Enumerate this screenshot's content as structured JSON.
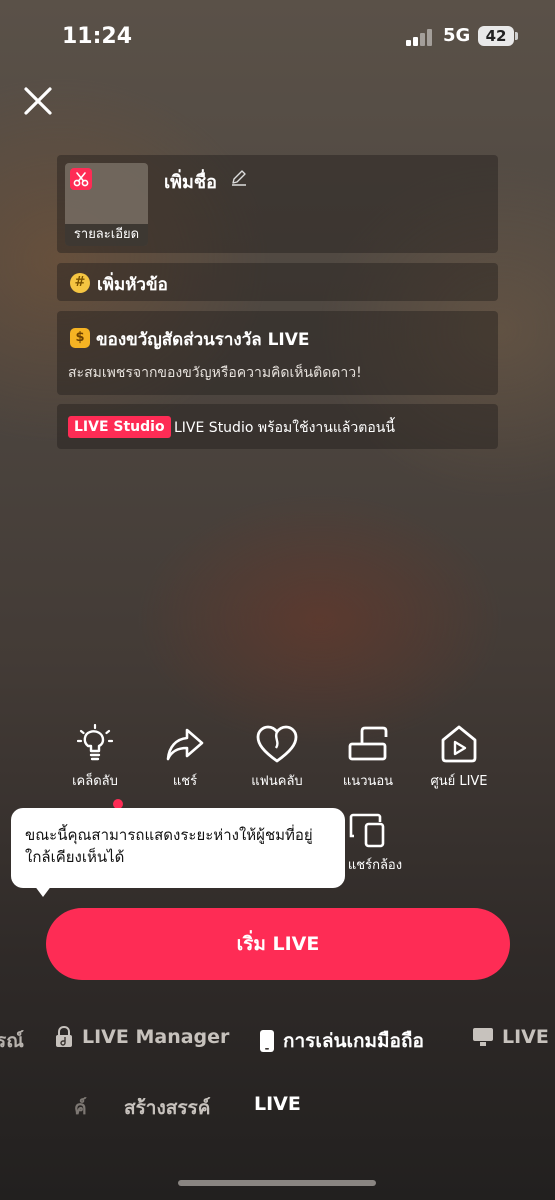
{
  "status_bar": {
    "time": "11:24",
    "network": "5G",
    "battery": "42"
  },
  "title_card": {
    "thumb_label": "รายละเอียด",
    "add_name": "เพิ่มชื่อ"
  },
  "topic": {
    "label": "เพิ่มหัวข้อ"
  },
  "gift": {
    "title": "ของขวัญสัดส่วนรางวัล LIVE",
    "subtitle": "สะสมเพชรจากของขวัญหรือความคิดเห็นติดดาว!"
  },
  "studio": {
    "badge": "LIVE Studio",
    "text": "LIVE Studio พร้อมใช้งานแล้วตอนนี้"
  },
  "tools": [
    {
      "label": "เคล็ดลับ",
      "icon": "lightbulb-icon"
    },
    {
      "label": "แชร์",
      "icon": "share-arrow-icon"
    },
    {
      "label": "แฟนคลับ",
      "icon": "heart-icon"
    },
    {
      "label": "แนวนอน",
      "icon": "landscape-icon"
    },
    {
      "label": "ศูนย์ LIVE",
      "icon": "live-center-icon"
    },
    {
      "label": "แชร์กล้อง",
      "icon": "share-camera-icon"
    }
  ],
  "tooltip": {
    "text": "ขณะนี้คุณสามารถแสดงระยะห่างให้ผู้ชมที่อยู่ใกล้เคียงเห็นได้"
  },
  "start_button": {
    "label": "เริ่ม LIVE"
  },
  "modes": {
    "left_partial": "รณ์",
    "live_manager": "LIVE Manager",
    "mobile_gaming": "การเล่นเกมมือถือ",
    "right_partial": "LIVE S"
  },
  "bottom_tabs": {
    "partial": "ค์",
    "create": "สร้างสรรค์",
    "live": "LIVE"
  },
  "colors": {
    "accent": "#fe2c55",
    "tooltip_bg": "#ffffff",
    "coin": "#f5b323"
  }
}
